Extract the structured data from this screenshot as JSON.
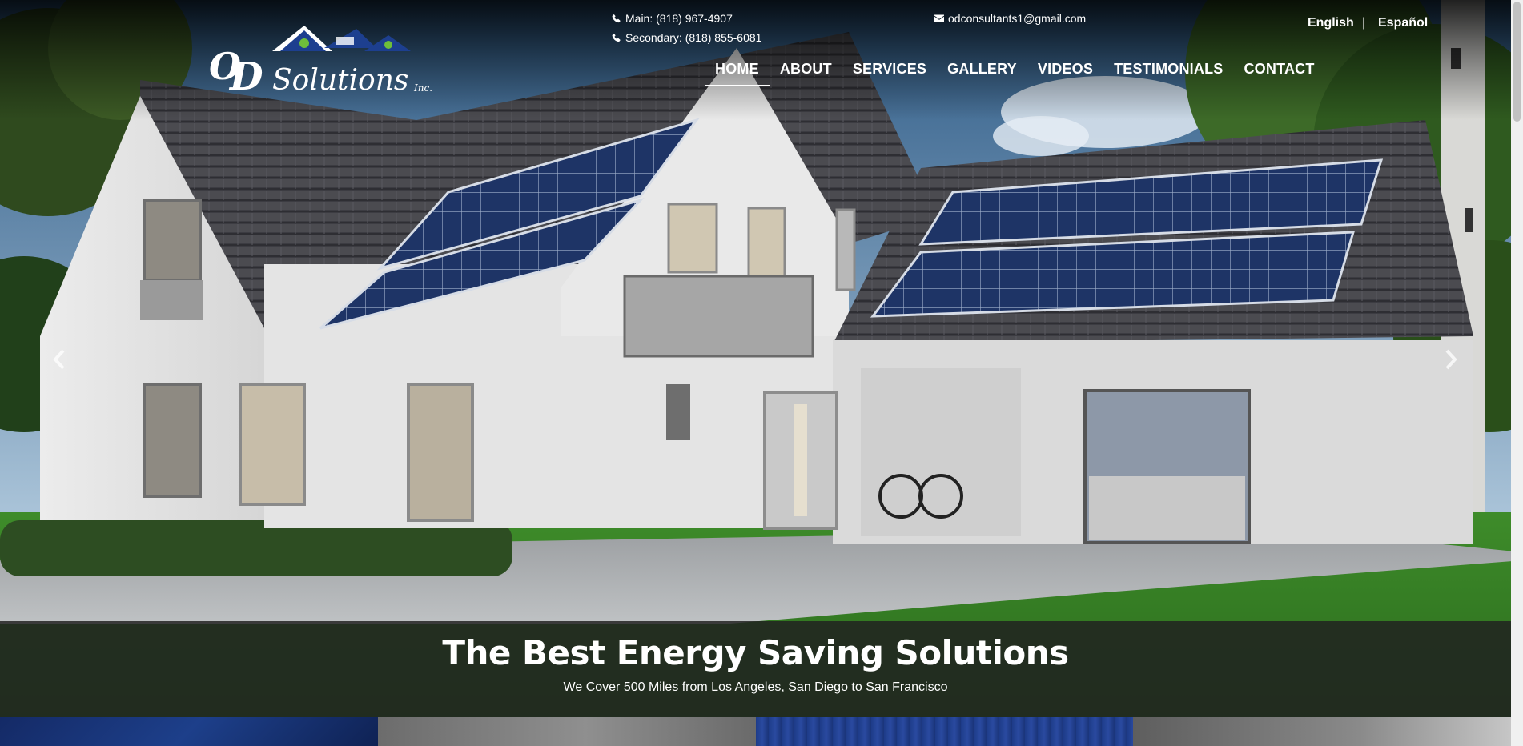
{
  "header": {
    "logo_text": "OD Solutions Inc.",
    "phone_main": "Main: (818) 967-4907",
    "phone_secondary": "Secondary: (818) 855-6081",
    "email": "odconsultants1@gmail.com",
    "languages": [
      "English",
      "Español"
    ],
    "language_separator": "|"
  },
  "nav": {
    "items": [
      {
        "label": "HOME",
        "active": true
      },
      {
        "label": "ABOUT"
      },
      {
        "label": "SERVICES"
      },
      {
        "label": "GALLERY"
      },
      {
        "label": "VIDEOS"
      },
      {
        "label": "TESTIMONIALS"
      },
      {
        "label": "CONTACT"
      }
    ]
  },
  "slider": {
    "prev_icon": "chevron-left-icon",
    "next_icon": "chevron-right-icon"
  },
  "caption": {
    "title": "The Best Energy Saving Solutions",
    "subtitle": "We Cover 500 Miles from Los Angeles, San Diego to San Francisco"
  },
  "icons": {
    "phone": "phone-icon",
    "email": "envelope-icon"
  },
  "colors": {
    "logo_blue": "#1d3f8f",
    "caption_band": "#202020",
    "nav_text": "#ffffff"
  }
}
